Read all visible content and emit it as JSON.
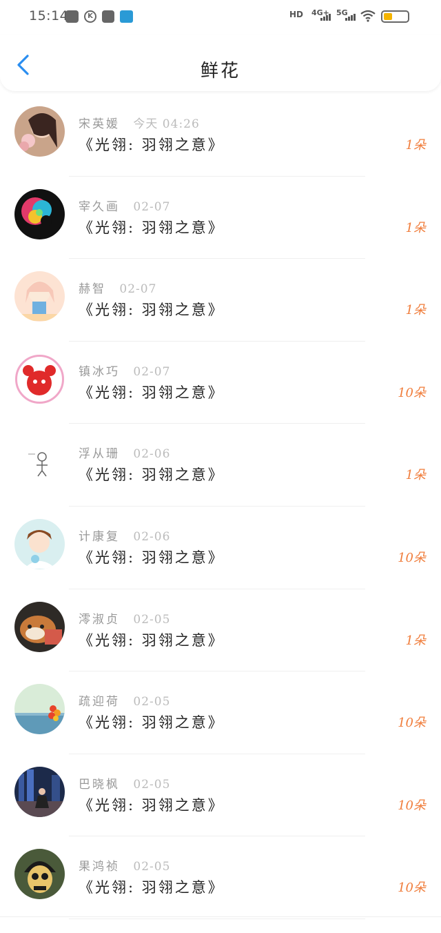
{
  "status_bar": {
    "time": "15:14",
    "hd_label": "HD",
    "net1_label": "4G+",
    "net2_label": "5G",
    "icons": [
      "game-icon",
      "k-icon",
      "cat-icon",
      "hotspot-icon",
      "wifi-icon",
      "battery-icon"
    ],
    "battery_color": "#f5b400"
  },
  "header": {
    "title": "鲜花",
    "back_icon": "chevron-left-icon",
    "back_color": "#2a8ef0"
  },
  "colors": {
    "count": "#f07c3a",
    "time": "#bbbbbb",
    "name": "#999999"
  },
  "records": [
    {
      "name": "宋英媛",
      "time": "今天 04:26",
      "gift": "《光翎: 羽翎之意》",
      "count": "1朵",
      "avatar": "woman-portrait"
    },
    {
      "name": "宰久画",
      "time": "02-07",
      "gift": "《光翎: 羽翎之意》",
      "count": "1朵",
      "avatar": "colorful-abstract"
    },
    {
      "name": "赫智",
      "time": "02-07",
      "gift": "《光翎: 羽翎之意》",
      "count": "1朵",
      "avatar": "anime-girl"
    },
    {
      "name": "镇冰巧",
      "time": "02-07",
      "gift": "《光翎: 羽翎之意》",
      "count": "10朵",
      "avatar": "red-crab-cartoon"
    },
    {
      "name": "浮从珊",
      "time": "02-06",
      "gift": "《光翎: 羽翎之意》",
      "count": "1朵",
      "avatar": "sketch-figure"
    },
    {
      "name": "计康复",
      "time": "02-06",
      "gift": "《光翎: 羽翎之意》",
      "count": "10朵",
      "avatar": "anime-boy"
    },
    {
      "name": "澪淑贞",
      "time": "02-05",
      "gift": "《光翎: 羽翎之意》",
      "count": "1朵",
      "avatar": "shiba-dog"
    },
    {
      "name": "疏迎荷",
      "time": "02-05",
      "gift": "《光翎: 羽翎之意》",
      "count": "10朵",
      "avatar": "sea-balloons"
    },
    {
      "name": "巴晓枫",
      "time": "02-05",
      "gift": "《光翎: 羽翎之意》",
      "count": "10朵",
      "avatar": "city-night-person"
    },
    {
      "name": "果鸿祯",
      "time": "02-05",
      "gift": "《光翎: 羽翎之意》",
      "count": "10朵",
      "avatar": "skull-cartoon"
    }
  ]
}
